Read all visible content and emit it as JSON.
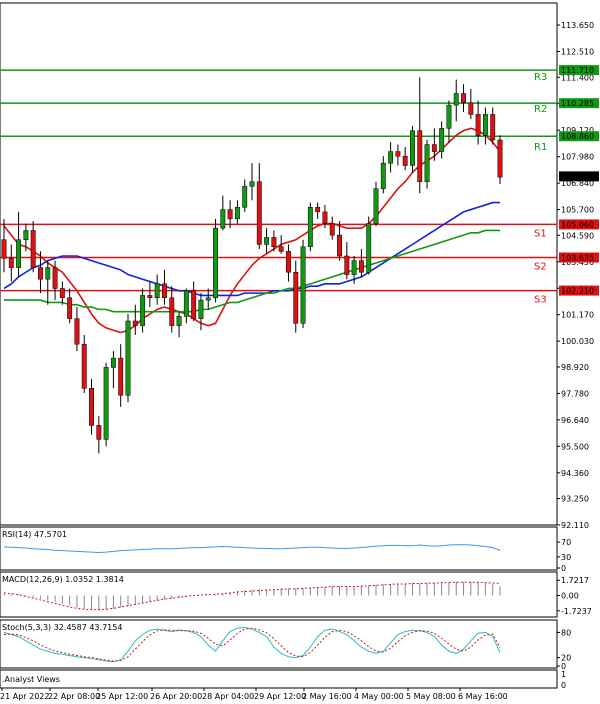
{
  "chart_data": {
    "type": "candlestick",
    "y_range": [
      92.11,
      114.6
    ],
    "y_ticks": [
      "113.650",
      "112.510",
      "111.400",
      "110.280",
      "109.120",
      "107.980",
      "106.840",
      "105.700",
      "104.590",
      "103.450",
      "102.310",
      "101.170",
      "100.030",
      "98.920",
      "97.780",
      "96.640",
      "95.500",
      "94.360",
      "93.250",
      "92.110"
    ],
    "x_labels": [
      "21 Apr 2022",
      "22 Apr 08:00",
      "25 Apr 12:00",
      "26 Apr 20:00",
      "28 Apr 04:00",
      "29 Apr 12:00",
      "2 May 16:00",
      "4 May 00:00",
      "5 May 08:00",
      "6 May 16:00"
    ],
    "current_price": "107.130",
    "levels": [
      {
        "name": "R3",
        "value": 111.71,
        "label": "111.710",
        "color": "#119911"
      },
      {
        "name": "R2",
        "value": 110.285,
        "label": "110.285",
        "color": "#119911"
      },
      {
        "name": "R1",
        "value": 108.86,
        "label": "108.860",
        "color": "#119911"
      },
      {
        "name": "S1",
        "value": 105.06,
        "label": "105.060",
        "color": "#dd1111"
      },
      {
        "name": "S2",
        "value": 103.635,
        "label": "103.635",
        "color": "#dd1111"
      },
      {
        "name": "S3",
        "value": 102.21,
        "label": "102.210",
        "color": "#dd1111"
      }
    ],
    "candles": [
      [
        104.4,
        105.3,
        103.0,
        103.6
      ],
      [
        103.6,
        104.2,
        102.6,
        103.2
      ],
      [
        103.2,
        105.6,
        102.8,
        104.4
      ],
      [
        104.4,
        105.1,
        103.9,
        104.8
      ],
      [
        104.8,
        105.2,
        103.0,
        103.2
      ],
      [
        103.2,
        103.9,
        102.1,
        102.7
      ],
      [
        102.7,
        103.5,
        101.6,
        103.2
      ],
      [
        103.2,
        103.5,
        101.8,
        102.3
      ],
      [
        102.3,
        102.6,
        101.6,
        101.9
      ],
      [
        101.9,
        102.3,
        100.8,
        101.0
      ],
      [
        101.0,
        101.5,
        99.6,
        99.9
      ],
      [
        99.9,
        100.3,
        97.8,
        98.0
      ],
      [
        98.0,
        98.4,
        96.0,
        96.4
      ],
      [
        96.4,
        96.8,
        95.2,
        95.8
      ],
      [
        95.8,
        99.1,
        95.5,
        98.9
      ],
      [
        98.9,
        99.6,
        98.0,
        99.3
      ],
      [
        99.3,
        99.9,
        97.2,
        97.7
      ],
      [
        97.7,
        101.2,
        97.4,
        100.9
      ],
      [
        100.9,
        101.6,
        100.3,
        100.7
      ],
      [
        100.7,
        102.3,
        100.4,
        102.0
      ],
      [
        102.0,
        102.6,
        101.5,
        101.9
      ],
      [
        101.9,
        102.9,
        101.6,
        102.5
      ],
      [
        102.5,
        103.1,
        101.6,
        101.9
      ],
      [
        101.9,
        102.4,
        100.4,
        100.7
      ],
      [
        100.7,
        101.3,
        100.2,
        101.1
      ],
      [
        101.1,
        102.3,
        100.8,
        102.2
      ],
      [
        102.2,
        102.6,
        100.9,
        101.0
      ],
      [
        101.0,
        102.1,
        100.5,
        101.8
      ],
      [
        101.8,
        102.3,
        101.4,
        101.9
      ],
      [
        101.9,
        105.3,
        101.7,
        104.9
      ],
      [
        104.9,
        106.3,
        104.8,
        105.7
      ],
      [
        105.7,
        106.1,
        104.9,
        105.3
      ],
      [
        105.3,
        106.1,
        105.1,
        105.8
      ],
      [
        105.8,
        107.0,
        105.6,
        106.7
      ],
      [
        106.7,
        107.7,
        106.1,
        106.9
      ],
      [
        106.9,
        107.7,
        104.0,
        104.2
      ],
      [
        104.2,
        104.9,
        103.8,
        104.5
      ],
      [
        104.5,
        104.8,
        103.9,
        104.1
      ],
      [
        104.1,
        104.6,
        103.8,
        103.9
      ],
      [
        103.9,
        104.2,
        102.6,
        103.0
      ],
      [
        103.0,
        103.5,
        100.4,
        100.8
      ],
      [
        100.8,
        104.4,
        100.6,
        104.1
      ],
      [
        104.1,
        106.0,
        103.9,
        105.8
      ],
      [
        105.8,
        106.0,
        105.3,
        105.6
      ],
      [
        105.6,
        105.9,
        104.9,
        105.1
      ],
      [
        105.1,
        105.4,
        104.4,
        104.6
      ],
      [
        104.6,
        105.2,
        103.5,
        103.7
      ],
      [
        103.7,
        104.3,
        102.7,
        102.9
      ],
      [
        102.9,
        103.7,
        102.5,
        103.5
      ],
      [
        103.5,
        104.0,
        102.8,
        103.0
      ],
      [
        103.0,
        105.4,
        102.9,
        105.1
      ],
      [
        105.1,
        106.9,
        105.0,
        106.6
      ],
      [
        106.6,
        108.0,
        106.4,
        107.7
      ],
      [
        107.7,
        108.6,
        107.3,
        108.2
      ],
      [
        108.2,
        108.5,
        107.6,
        108.0
      ],
      [
        108.0,
        108.4,
        107.4,
        107.6
      ],
      [
        107.6,
        109.3,
        107.3,
        109.1
      ],
      [
        109.1,
        111.4,
        106.4,
        106.9
      ],
      [
        106.9,
        108.7,
        106.6,
        108.5
      ],
      [
        108.5,
        109.2,
        107.8,
        108.2
      ],
      [
        108.2,
        109.5,
        107.9,
        109.2
      ],
      [
        109.2,
        110.4,
        108.6,
        110.2
      ],
      [
        110.2,
        111.3,
        109.5,
        110.7
      ],
      [
        110.7,
        111.1,
        109.9,
        110.3
      ],
      [
        110.3,
        110.9,
        109.6,
        109.8
      ],
      [
        109.8,
        110.4,
        108.5,
        108.9
      ],
      [
        108.9,
        110.1,
        108.5,
        109.8
      ],
      [
        109.8,
        110.1,
        108.5,
        108.7
      ],
      [
        108.7,
        108.9,
        106.8,
        107.1
      ]
    ],
    "series": [
      {
        "name": "",
        "color": "#dd1111",
        "values": [
          105.0,
          104.6,
          104.2,
          104.1,
          103.9,
          103.7,
          103.4,
          103.2,
          103.0,
          102.6,
          102.2,
          101.7,
          101.2,
          100.8,
          100.6,
          100.5,
          100.4,
          100.5,
          100.7,
          101.0,
          101.2,
          101.4,
          101.5,
          101.4,
          101.3,
          101.2,
          101.0,
          100.8,
          100.7,
          100.8,
          101.4,
          102.0,
          102.5,
          102.9,
          103.3,
          103.6,
          103.8,
          104.0,
          104.2,
          104.3,
          104.4,
          104.6,
          104.8,
          105.0,
          105.1,
          105.1,
          105.0,
          104.9,
          104.9,
          104.9,
          105.1,
          105.4,
          105.8,
          106.2,
          106.6,
          106.9,
          107.3,
          107.6,
          107.8,
          108.0,
          108.3,
          108.6,
          108.9,
          109.1,
          109.2,
          109.1,
          108.9,
          108.6,
          108.2
        ]
      },
      {
        "name": "",
        "color": "#1122dd",
        "values": [
          102.3,
          102.5,
          102.8,
          103.0,
          103.2,
          103.3,
          103.5,
          103.6,
          103.7,
          103.7,
          103.7,
          103.6,
          103.5,
          103.4,
          103.3,
          103.2,
          103.1,
          102.9,
          102.8,
          102.7,
          102.6,
          102.5,
          102.4,
          102.3,
          102.2,
          102.2,
          102.1,
          102.0,
          102.0,
          102.0,
          102.0,
          102.0,
          102.0,
          102.1,
          102.1,
          102.1,
          102.1,
          102.2,
          102.2,
          102.2,
          102.3,
          102.3,
          102.4,
          102.4,
          102.5,
          102.5,
          102.5,
          102.6,
          102.7,
          102.8,
          103.0,
          103.2,
          103.4,
          103.6,
          103.8,
          104.0,
          104.2,
          104.4,
          104.6,
          104.8,
          105.0,
          105.2,
          105.4,
          105.6,
          105.7,
          105.8,
          105.9,
          106.0,
          106.0
        ]
      },
      {
        "name": "",
        "color": "#119911",
        "values": [
          101.8,
          101.8,
          101.8,
          101.8,
          101.8,
          101.8,
          101.7,
          101.7,
          101.7,
          101.6,
          101.6,
          101.5,
          101.5,
          101.4,
          101.4,
          101.3,
          101.3,
          101.3,
          101.3,
          101.3,
          101.3,
          101.3,
          101.3,
          101.3,
          101.3,
          101.3,
          101.3,
          101.4,
          101.4,
          101.5,
          101.6,
          101.7,
          101.7,
          101.8,
          101.9,
          102.0,
          102.1,
          102.1,
          102.2,
          102.3,
          102.3,
          102.4,
          102.5,
          102.6,
          102.7,
          102.8,
          102.9,
          103.0,
          103.1,
          103.2,
          103.3,
          103.4,
          103.5,
          103.6,
          103.7,
          103.8,
          103.9,
          104.0,
          104.1,
          104.2,
          104.3,
          104.4,
          104.5,
          104.6,
          104.7,
          104.7,
          104.8,
          104.8,
          104.8
        ]
      }
    ],
    "rsi": {
      "label": "RSI(14) 47.5701",
      "ticks": [
        "70",
        "30",
        "0"
      ],
      "range": [
        0,
        100
      ],
      "values": [
        57,
        56,
        55,
        54,
        52,
        51,
        50,
        48,
        47,
        46,
        45,
        44,
        43,
        42,
        43,
        45,
        47,
        48,
        49,
        50,
        51,
        52,
        52,
        52,
        53,
        54,
        55,
        55,
        56,
        57,
        58,
        57,
        56,
        55,
        54,
        53,
        53,
        52,
        52,
        53,
        54,
        55,
        56,
        56,
        55,
        54,
        53,
        53,
        54,
        55,
        57,
        59,
        60,
        61,
        61,
        60,
        60,
        62,
        60,
        59,
        60,
        62,
        63,
        63,
        62,
        60,
        58,
        55,
        48
      ]
    },
    "macd": {
      "label": "MACD(12,26,9) 1.0352 1.3814",
      "ticks": [
        "1.7217",
        "0.00",
        "-1.7237"
      ],
      "range": [
        -2.2,
        2.2
      ],
      "signal": [
        0.3,
        0.2,
        0.1,
        -0.1,
        -0.3,
        -0.5,
        -0.7,
        -0.9,
        -1.1,
        -1.3,
        -1.45,
        -1.55,
        -1.6,
        -1.6,
        -1.55,
        -1.45,
        -1.3,
        -1.15,
        -1.0,
        -0.85,
        -0.7,
        -0.55,
        -0.4,
        -0.3,
        -0.2,
        -0.1,
        0.0,
        0.05,
        0.1,
        0.15,
        0.2,
        0.3,
        0.4,
        0.45,
        0.5,
        0.55,
        0.6,
        0.65,
        0.7,
        0.75,
        0.75,
        0.8,
        0.85,
        0.9,
        0.95,
        1.0,
        1.0,
        1.0,
        1.0,
        1.05,
        1.1,
        1.15,
        1.2,
        1.25,
        1.3,
        1.3,
        1.35,
        1.35,
        1.4,
        1.4,
        1.45,
        1.45,
        1.5,
        1.5,
        1.5,
        1.5,
        1.45,
        1.4,
        1.38
      ],
      "hist": [
        0.2,
        0.15,
        0.1,
        -0.05,
        -0.2,
        -0.35,
        -0.55,
        -0.75,
        -0.95,
        -1.15,
        -1.35,
        -1.5,
        -1.6,
        -1.65,
        -1.6,
        -1.5,
        -1.35,
        -1.2,
        -1.05,
        -0.9,
        -0.75,
        -0.6,
        -0.45,
        -0.35,
        -0.25,
        -0.15,
        -0.05,
        0.0,
        0.05,
        0.1,
        0.2,
        0.35,
        0.5,
        0.6,
        0.65,
        0.7,
        0.7,
        0.75,
        0.8,
        0.8,
        0.8,
        0.85,
        0.9,
        0.95,
        1.0,
        1.05,
        1.05,
        1.05,
        1.05,
        1.1,
        1.15,
        1.2,
        1.25,
        1.3,
        1.3,
        1.35,
        1.4,
        1.35,
        1.4,
        1.45,
        1.5,
        1.5,
        1.55,
        1.55,
        1.55,
        1.5,
        1.4,
        1.3,
        1.04
      ]
    },
    "stoch": {
      "label": "Stoch(5,3,3) 32.4587 43.7154",
      "ticks": [
        "80",
        "20",
        "0"
      ],
      "range": [
        0,
        100
      ],
      "k": [
        80,
        75,
        70,
        60,
        50,
        40,
        35,
        30,
        28,
        25,
        22,
        20,
        18,
        15,
        12,
        10,
        15,
        35,
        60,
        75,
        85,
        88,
        85,
        82,
        86,
        84,
        80,
        70,
        50,
        35,
        60,
        82,
        90,
        92,
        88,
        80,
        70,
        45,
        30,
        22,
        20,
        25,
        45,
        70,
        85,
        88,
        82,
        75,
        60,
        45,
        35,
        30,
        35,
        55,
        75,
        82,
        85,
        84,
        80,
        70,
        50,
        35,
        30,
        40,
        60,
        78,
        80,
        70,
        32
      ],
      "d": [
        75,
        76,
        74,
        68,
        60,
        50,
        42,
        36,
        32,
        28,
        25,
        22,
        20,
        17,
        14,
        12,
        13,
        22,
        40,
        58,
        74,
        84,
        86,
        85,
        84,
        84,
        83,
        78,
        66,
        52,
        48,
        62,
        78,
        88,
        90,
        86,
        79,
        65,
        48,
        32,
        24,
        22,
        32,
        50,
        68,
        82,
        85,
        82,
        72,
        60,
        46,
        36,
        33,
        42,
        58,
        72,
        80,
        84,
        83,
        78,
        66,
        52,
        40,
        35,
        45,
        62,
        74,
        76,
        44
      ]
    },
    "footer": ".Analyst Views",
    "colors": {
      "up": "#119911",
      "down": "#dd1111",
      "rsi": "#3399ee",
      "macd_signal": "#dd1111",
      "macd_hist": "#888888",
      "stoch_k": "#22bbcc",
      "stoch_d": "#dd1111"
    }
  }
}
